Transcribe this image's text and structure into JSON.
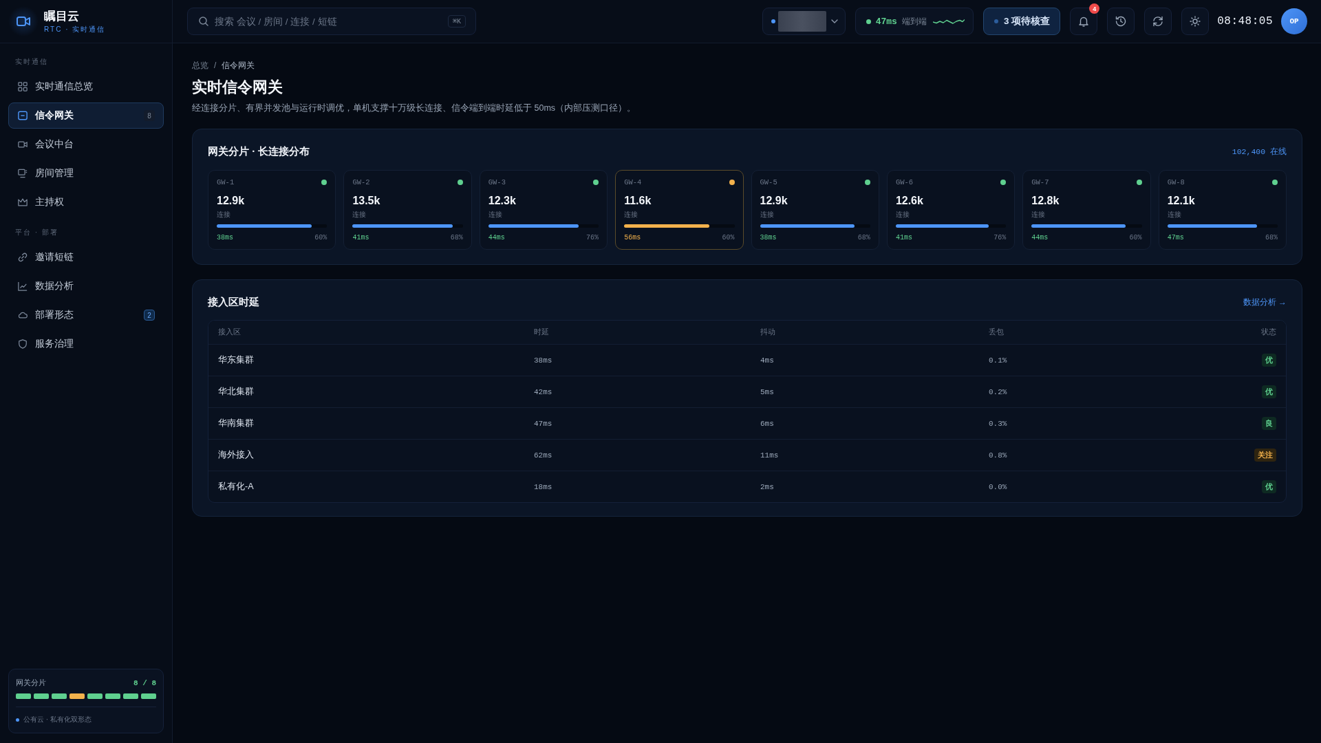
{
  "brand": {
    "name": "瞩目云",
    "tagline": "RTC · 实时通信"
  },
  "search": {
    "placeholder": "搜索 会议 / 房间 / 连接 / 短链",
    "shortcut": "⌘K"
  },
  "latency_pill": {
    "value": "47ms",
    "label": "端到端"
  },
  "review_button": {
    "label": "3 项待核查"
  },
  "notifications": {
    "count": "4"
  },
  "clock": "08:48:05",
  "avatar": {
    "initials": "OP"
  },
  "nav": [
    {
      "label": "实时通信",
      "items": [
        {
          "label": "实时通信总览",
          "selected": false
        },
        {
          "label": "信令网关",
          "selected": true,
          "badge": "8",
          "badge_accent": false
        },
        {
          "label": "会议中台",
          "selected": false
        },
        {
          "label": "房间管理",
          "selected": false
        },
        {
          "label": "主持权",
          "selected": false
        }
      ]
    },
    {
      "label": "平台 · 部署",
      "items": [
        {
          "label": "邀请短链",
          "selected": false
        },
        {
          "label": "数据分析",
          "selected": false
        },
        {
          "label": "部署形态",
          "selected": false,
          "badge": "2",
          "badge_accent": true
        },
        {
          "label": "服务治理",
          "selected": false
        }
      ]
    }
  ],
  "shard_summary": {
    "label": "网关分片",
    "count": "8 / 8",
    "segments": [
      {
        "color": "#5fd08f"
      },
      {
        "color": "#5fd08f"
      },
      {
        "color": "#5fd08f"
      },
      {
        "color": "#f2b14c"
      },
      {
        "color": "#5fd08f"
      },
      {
        "color": "#5fd08f"
      },
      {
        "color": "#5fd08f"
      },
      {
        "color": "#5fd08f"
      }
    ],
    "footnote": "公有云 · 私有化双形态"
  },
  "breadcrumb": {
    "items": [
      "总览",
      "信令网关"
    ],
    "separator": "/"
  },
  "page": {
    "title": "实时信令网关",
    "description": "经连接分片、有界并发池与运行时调优，单机支撑十万级长连接、信令端到端时延低于 50ms（内部压测口径）。"
  },
  "gateways": {
    "title": "网关分片 · 长连接分布",
    "online": "102,400 在线",
    "items": [
      {
        "name": "GW-1",
        "value": "12.9k",
        "unit": "连接",
        "level": 0.86,
        "latency": "38ms",
        "share": "60%",
        "warning": false
      },
      {
        "name": "GW-2",
        "value": "13.5k",
        "unit": "连接",
        "level": 0.91,
        "latency": "41ms",
        "share": "68%",
        "warning": false
      },
      {
        "name": "GW-3",
        "value": "12.3k",
        "unit": "连接",
        "level": 0.82,
        "latency": "44ms",
        "share": "76%",
        "warning": false
      },
      {
        "name": "GW-4",
        "value": "11.6k",
        "unit": "连接",
        "level": 0.77,
        "latency": "56ms",
        "share": "60%",
        "warning": true
      },
      {
        "name": "GW-5",
        "value": "12.9k",
        "unit": "连接",
        "level": 0.86,
        "latency": "38ms",
        "share": "68%",
        "warning": false
      },
      {
        "name": "GW-6",
        "value": "12.6k",
        "unit": "连接",
        "level": 0.84,
        "latency": "41ms",
        "share": "76%",
        "warning": false
      },
      {
        "name": "GW-7",
        "value": "12.8k",
        "unit": "连接",
        "level": 0.85,
        "latency": "44ms",
        "share": "60%",
        "warning": false
      },
      {
        "name": "GW-8",
        "value": "12.1k",
        "unit": "连接",
        "level": 0.81,
        "latency": "47ms",
        "share": "68%",
        "warning": false
      }
    ]
  },
  "latency_table": {
    "title": "接入区时延",
    "link": "数据分析 →",
    "columns": [
      "接入区",
      "时延",
      "抖动",
      "丢包",
      "状态"
    ],
    "rows": [
      {
        "cells": [
          "华东集群",
          "38ms",
          "4ms",
          "0.1%"
        ],
        "status": "优",
        "warning": false
      },
      {
        "cells": [
          "华北集群",
          "42ms",
          "5ms",
          "0.2%"
        ],
        "status": "优",
        "warning": false
      },
      {
        "cells": [
          "华南集群",
          "47ms",
          "6ms",
          "0.3%"
        ],
        "status": "良",
        "warning": false
      },
      {
        "cells": [
          "海外接入",
          "62ms",
          "11ms",
          "0.8%"
        ],
        "status": "关注",
        "warning": true
      },
      {
        "cells": [
          "私有化-A",
          "18ms",
          "2ms",
          "0.0%"
        ],
        "status": "优",
        "warning": false
      }
    ]
  }
}
